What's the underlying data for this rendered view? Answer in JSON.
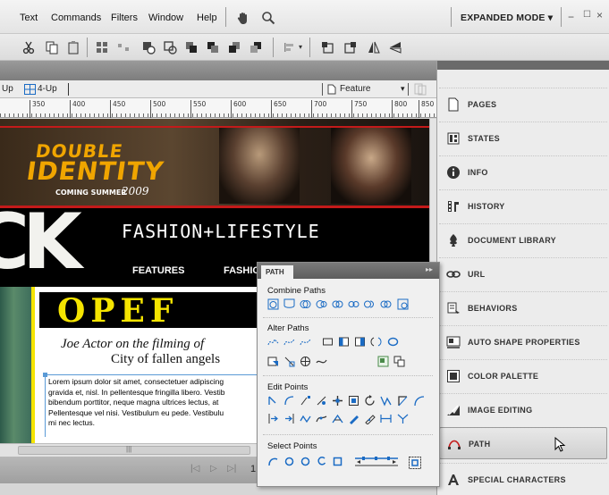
{
  "menu": {
    "items": [
      "Text",
      "Commands",
      "Filters",
      "Window",
      "Help"
    ]
  },
  "mode": {
    "label": "EXPANDED MODE ▾"
  },
  "viewbar": {
    "up_partial": "Up",
    "four_up": "4-Up",
    "feature": "Feature"
  },
  "ruler": {
    "labels": [
      "350",
      "400",
      "450",
      "500",
      "550",
      "600",
      "650",
      "700",
      "750",
      "800",
      "850"
    ]
  },
  "canvas": {
    "banner_line1": "DOUBLE",
    "banner_line2": "IDENTITY",
    "banner_tag": "COMING SUMMER",
    "banner_year": "2009",
    "logo_fragment": "CK",
    "fashion_title": "FASHION+LIFESTYLE",
    "nav_features": "FEATURES",
    "nav_fashion": "FASHIO",
    "headline": "OPEF",
    "caption_line1": "Joe Actor on the filming of",
    "caption_line2": "City of fallen angels",
    "lorem_lines": [
      "Lorem ipsum dolor sit amet, consectetuer adipiscing",
      "gravida et, nisl. In pellentesque fringilla libero. Vestib",
      "bibendum porttitor, neque magna ultrices lectus, at",
      "Pellentesque vel nisi. Vestibulum eu pede. Vestibulu",
      "mi nec lectus."
    ]
  },
  "statusbar": {
    "page_partial": "1"
  },
  "right_panel": {
    "items": [
      {
        "label": "PAGES",
        "icon": "pages-icon"
      },
      {
        "label": "STATES",
        "icon": "states-icon"
      },
      {
        "label": "INFO",
        "icon": "info-icon"
      },
      {
        "label": "HISTORY",
        "icon": "history-icon"
      },
      {
        "label": "DOCUMENT LIBRARY",
        "icon": "document-library-icon"
      },
      {
        "label": "URL",
        "icon": "url-icon"
      },
      {
        "label": "BEHAVIORS",
        "icon": "behaviors-icon"
      },
      {
        "label": "AUTO SHAPE PROPERTIES",
        "icon": "auto-shape-icon"
      },
      {
        "label": "COLOR PALETTE",
        "icon": "color-palette-icon"
      },
      {
        "label": "IMAGE EDITING",
        "icon": "image-editing-icon"
      },
      {
        "label": "PATH",
        "icon": "path-icon",
        "active": true
      },
      {
        "label": "SPECIAL CHARACTERS",
        "icon": "special-characters-icon"
      }
    ]
  },
  "path_panel": {
    "tab": "PATH",
    "combine_paths": "Combine Paths",
    "alter_paths": "Alter Paths",
    "edit_points": "Edit Points",
    "select_points": "Select Points"
  },
  "colors": {
    "yellow": "#f5e400",
    "banner_gold": "#f0a500",
    "red_rule": "#c41a1a",
    "icon_blue": "#1a6bc4",
    "text_gray": "#333333"
  }
}
